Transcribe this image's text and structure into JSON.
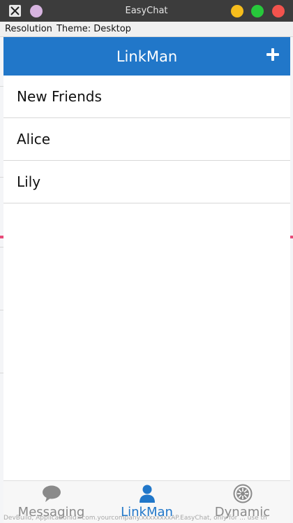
{
  "window": {
    "title": "EasyChat",
    "icons": {
      "app": "x-app-icon",
      "pin": "pin-icon",
      "minimize": "minimize-icon",
      "maximize": "maximize-icon",
      "close": "close-icon"
    },
    "colors": {
      "titlebar": "#3c3c3c",
      "minimize": "#f6bd1c",
      "maximize": "#27c83b",
      "close": "#f2534d"
    }
  },
  "menubar": {
    "resolution_label": "Resolution",
    "theme_label": "Theme: Desktop"
  },
  "header": {
    "title": "LinkMan",
    "add_icon": "plus-icon",
    "color": "#2177c9"
  },
  "contacts": [
    {
      "name": "New Friends"
    },
    {
      "name": "Alice"
    },
    {
      "name": "Lily"
    }
  ],
  "tabs": [
    {
      "label": "Messaging",
      "icon": "chat-bubble-icon",
      "active": false
    },
    {
      "label": "LinkMan",
      "icon": "person-icon",
      "active": true
    },
    {
      "label": "Dynamic",
      "icon": "aperture-icon",
      "active": false
    }
  ],
  "status_text": "DevBuild, ApplicationId=com.yourcompany.xxxxxxxxAP.EasyChat, only for ... use th"
}
